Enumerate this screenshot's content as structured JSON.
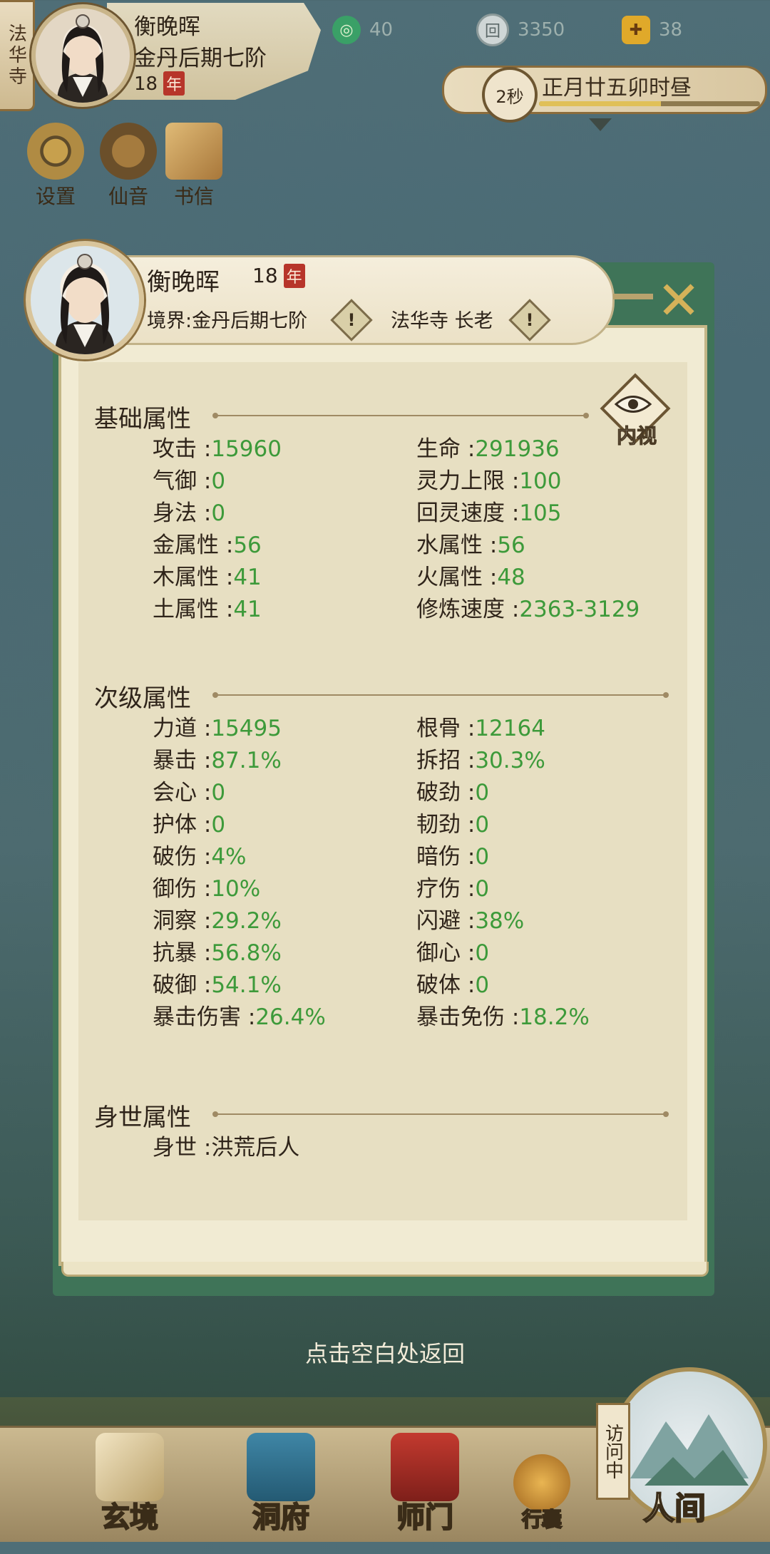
{
  "topbar": {
    "sect": "法华寺",
    "name": "衡晚晖",
    "realm": "金丹后期七阶",
    "age": "18",
    "age_unit": "年",
    "resources": {
      "jade": "40",
      "coin": "3350",
      "strength": "38"
    },
    "time_seconds": "2秒",
    "time_text": "正月廿五卯时昼",
    "time_progress": 0.55,
    "quick": [
      "设置",
      "仙音",
      "书信"
    ]
  },
  "panel": {
    "name": "衡晚晖",
    "age": "18",
    "age_unit": "年",
    "realm": "境界:金丹后期七阶",
    "sect": "法华寺 长老",
    "eye_label": "内视",
    "sections": [
      {
        "title": "基础属性",
        "rows": [
          [
            {
              "k": "攻击",
              "v": "15960"
            },
            {
              "k": "生命",
              "v": "291936"
            }
          ],
          [
            {
              "k": "气御",
              "v": "0"
            },
            {
              "k": "灵力上限",
              "v": "100"
            }
          ],
          [
            {
              "k": "身法",
              "v": "0"
            },
            {
              "k": "回灵速度",
              "v": "105"
            }
          ],
          [
            {
              "k": "金属性",
              "v": "56"
            },
            {
              "k": "水属性",
              "v": "56"
            }
          ],
          [
            {
              "k": "木属性",
              "v": "41"
            },
            {
              "k": "火属性",
              "v": "48"
            }
          ],
          [
            {
              "k": "土属性",
              "v": "41"
            },
            {
              "k": "修炼速度",
              "v": "2363-3129"
            }
          ]
        ]
      },
      {
        "title": "次级属性",
        "rows": [
          [
            {
              "k": "力道",
              "v": "15495"
            },
            {
              "k": "根骨",
              "v": "12164"
            }
          ],
          [
            {
              "k": "暴击",
              "v": "87.1%"
            },
            {
              "k": "拆招",
              "v": "30.3%"
            }
          ],
          [
            {
              "k": "会心",
              "v": "0"
            },
            {
              "k": "破劲",
              "v": "0"
            }
          ],
          [
            {
              "k": "护体",
              "v": "0"
            },
            {
              "k": "韧劲",
              "v": "0"
            }
          ],
          [
            {
              "k": "破伤",
              "v": "4%"
            },
            {
              "k": "暗伤",
              "v": "0"
            }
          ],
          [
            {
              "k": "御伤",
              "v": "10%"
            },
            {
              "k": "疗伤",
              "v": "0"
            }
          ],
          [
            {
              "k": "洞察",
              "v": "29.2%"
            },
            {
              "k": "闪避",
              "v": "38%"
            }
          ],
          [
            {
              "k": "抗暴",
              "v": "56.8%"
            },
            {
              "k": "御心",
              "v": "0"
            }
          ],
          [
            {
              "k": "破御",
              "v": "54.1%"
            },
            {
              "k": "破体",
              "v": "0"
            }
          ],
          [
            {
              "k": "暴击伤害",
              "v": "26.4%"
            },
            {
              "k": "暴击免伤",
              "v": "18.2%"
            }
          ]
        ]
      },
      {
        "title": "身世属性",
        "rows": [
          [
            {
              "k": "身世",
              "v": "洪荒后人"
            }
          ]
        ]
      }
    ]
  },
  "return_hint": "点击空白处返回",
  "visit_tag": "访问中",
  "nav": [
    "玄境",
    "洞府",
    "师门",
    "行囊",
    "人间"
  ],
  "colors": {
    "value_green": "#3d9a3a",
    "panel_green": "#3f7458",
    "parchment": "#f1ebd3",
    "year_red": "#b7352a"
  }
}
